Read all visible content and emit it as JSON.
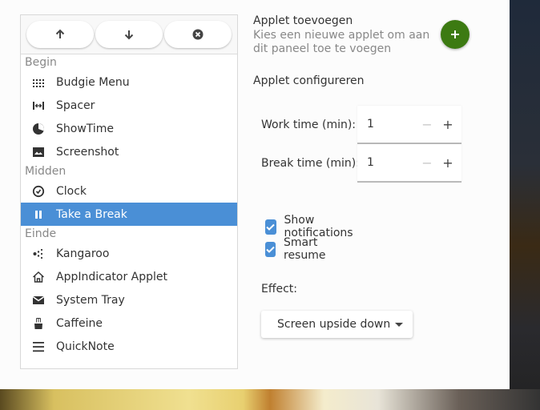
{
  "toolbar": {
    "buttons": [
      {
        "icon": "arrow-up-icon"
      },
      {
        "icon": "arrow-down-icon"
      },
      {
        "icon": "remove-circle-icon"
      }
    ]
  },
  "applet_list": {
    "sections": [
      {
        "label": "Begin",
        "items": [
          {
            "label": "Budgie Menu",
            "icon": "grid-dots-icon"
          },
          {
            "label": "Spacer",
            "icon": "spacer-icon"
          },
          {
            "label": "ShowTime",
            "icon": "clock-pie-icon"
          },
          {
            "label": "Screenshot",
            "icon": "image-icon"
          }
        ]
      },
      {
        "label": "Midden",
        "items": [
          {
            "label": "Clock",
            "icon": "clock-icon"
          },
          {
            "label": "Take a Break",
            "icon": "pause-icon",
            "selected": true
          }
        ]
      },
      {
        "label": "Einde",
        "items": [
          {
            "label": "Kangaroo",
            "icon": "kangaroo-dots-icon"
          },
          {
            "label": "AppIndicator Applet",
            "icon": "home-icon"
          },
          {
            "label": "System Tray",
            "icon": "envelope-icon"
          },
          {
            "label": "Caffeine",
            "icon": "coffee-cup-icon"
          },
          {
            "label": "QuickNote",
            "icon": "menu-lines-icon"
          }
        ]
      }
    ]
  },
  "add_applet": {
    "title": "Applet toevoegen",
    "subtitle": "Kies een nieuwe applet om aan dit paneel toe te voegen",
    "button_icon": "plus-icon"
  },
  "configure": {
    "title": "Applet configureren",
    "work_time": {
      "label": "Work time (min):",
      "value": "1"
    },
    "break_time": {
      "label": "Break time (min):",
      "value": "1"
    },
    "show_notifications": {
      "label": "Show notifications",
      "checked": true
    },
    "smart_resume": {
      "label": "Smart resume",
      "checked": true
    },
    "effect": {
      "label": "Effect:",
      "selected": "Screen upside down"
    }
  },
  "colors": {
    "selection": "#4a8fd6",
    "add_button": "#3c7a12",
    "checkbox": "#4a8fd6"
  }
}
